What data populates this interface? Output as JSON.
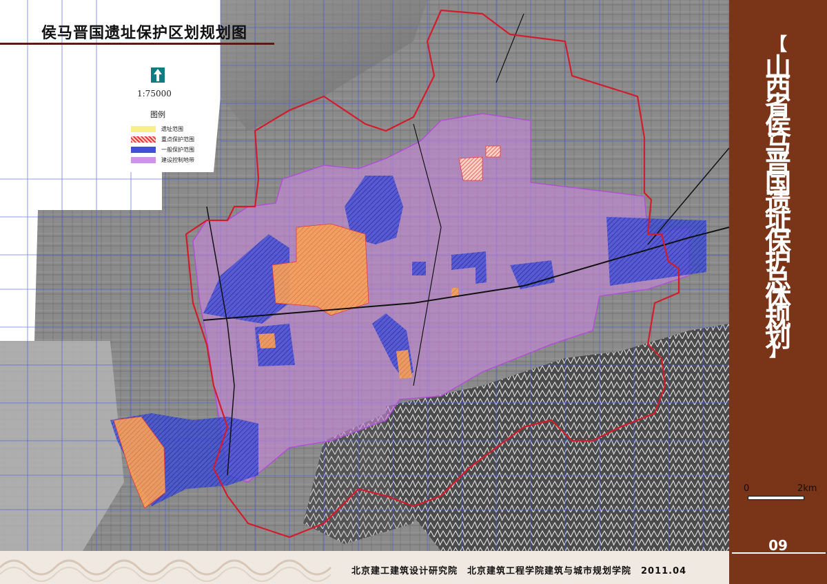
{
  "map": {
    "title": "侯马晋国遗址保护区划规划图",
    "scale_ratio": "1:75000",
    "north_label": "N",
    "legend": {
      "title": "图例",
      "items": [
        {
          "label": "遗址范围",
          "color": "#f9ef88"
        },
        {
          "label": "重点保护范围",
          "color": "#e8383b"
        },
        {
          "label": "一般保护范围",
          "color": "#3f4fd6"
        },
        {
          "label": "建设控制地带",
          "color": "#cf94e8"
        }
      ]
    },
    "colors": {
      "boundary": "#d31c2b",
      "site_fill": "#f59c56",
      "general_zone": "#3140d2",
      "control_zone": "#cc8ae6",
      "grid": "#4b5ce0"
    },
    "scale_bar": {
      "start": "0",
      "end": "2km"
    }
  },
  "panel": {
    "title_chars": [
      "山",
      "西",
      "省",
      "侯",
      "马",
      "晋",
      "国",
      "遗",
      "址",
      "保",
      "护",
      "总",
      "体",
      "规",
      "划"
    ],
    "bracket_open": "【",
    "bracket_close": "】",
    "page_number": "09",
    "background": "#7a3417"
  },
  "footer": {
    "credits": "北京建工建筑设计研究院　北京建筑工程学院建筑与城市规划学院　2011.04"
  }
}
